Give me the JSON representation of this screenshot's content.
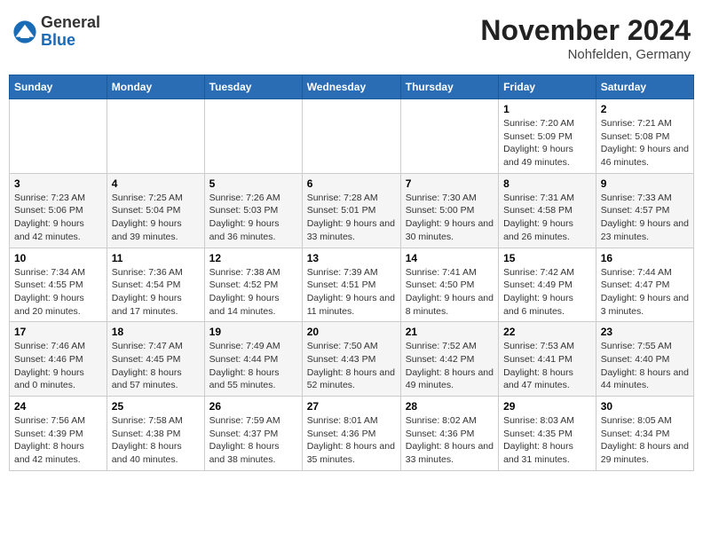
{
  "header": {
    "logo_general": "General",
    "logo_blue": "Blue",
    "month_title": "November 2024",
    "location": "Nohfelden, Germany"
  },
  "days_of_week": [
    "Sunday",
    "Monday",
    "Tuesday",
    "Wednesday",
    "Thursday",
    "Friday",
    "Saturday"
  ],
  "weeks": [
    [
      {
        "day": "",
        "info": ""
      },
      {
        "day": "",
        "info": ""
      },
      {
        "day": "",
        "info": ""
      },
      {
        "day": "",
        "info": ""
      },
      {
        "day": "",
        "info": ""
      },
      {
        "day": "1",
        "info": "Sunrise: 7:20 AM\nSunset: 5:09 PM\nDaylight: 9 hours and 49 minutes."
      },
      {
        "day": "2",
        "info": "Sunrise: 7:21 AM\nSunset: 5:08 PM\nDaylight: 9 hours and 46 minutes."
      }
    ],
    [
      {
        "day": "3",
        "info": "Sunrise: 7:23 AM\nSunset: 5:06 PM\nDaylight: 9 hours and 42 minutes."
      },
      {
        "day": "4",
        "info": "Sunrise: 7:25 AM\nSunset: 5:04 PM\nDaylight: 9 hours and 39 minutes."
      },
      {
        "day": "5",
        "info": "Sunrise: 7:26 AM\nSunset: 5:03 PM\nDaylight: 9 hours and 36 minutes."
      },
      {
        "day": "6",
        "info": "Sunrise: 7:28 AM\nSunset: 5:01 PM\nDaylight: 9 hours and 33 minutes."
      },
      {
        "day": "7",
        "info": "Sunrise: 7:30 AM\nSunset: 5:00 PM\nDaylight: 9 hours and 30 minutes."
      },
      {
        "day": "8",
        "info": "Sunrise: 7:31 AM\nSunset: 4:58 PM\nDaylight: 9 hours and 26 minutes."
      },
      {
        "day": "9",
        "info": "Sunrise: 7:33 AM\nSunset: 4:57 PM\nDaylight: 9 hours and 23 minutes."
      }
    ],
    [
      {
        "day": "10",
        "info": "Sunrise: 7:34 AM\nSunset: 4:55 PM\nDaylight: 9 hours and 20 minutes."
      },
      {
        "day": "11",
        "info": "Sunrise: 7:36 AM\nSunset: 4:54 PM\nDaylight: 9 hours and 17 minutes."
      },
      {
        "day": "12",
        "info": "Sunrise: 7:38 AM\nSunset: 4:52 PM\nDaylight: 9 hours and 14 minutes."
      },
      {
        "day": "13",
        "info": "Sunrise: 7:39 AM\nSunset: 4:51 PM\nDaylight: 9 hours and 11 minutes."
      },
      {
        "day": "14",
        "info": "Sunrise: 7:41 AM\nSunset: 4:50 PM\nDaylight: 9 hours and 8 minutes."
      },
      {
        "day": "15",
        "info": "Sunrise: 7:42 AM\nSunset: 4:49 PM\nDaylight: 9 hours and 6 minutes."
      },
      {
        "day": "16",
        "info": "Sunrise: 7:44 AM\nSunset: 4:47 PM\nDaylight: 9 hours and 3 minutes."
      }
    ],
    [
      {
        "day": "17",
        "info": "Sunrise: 7:46 AM\nSunset: 4:46 PM\nDaylight: 9 hours and 0 minutes."
      },
      {
        "day": "18",
        "info": "Sunrise: 7:47 AM\nSunset: 4:45 PM\nDaylight: 8 hours and 57 minutes."
      },
      {
        "day": "19",
        "info": "Sunrise: 7:49 AM\nSunset: 4:44 PM\nDaylight: 8 hours and 55 minutes."
      },
      {
        "day": "20",
        "info": "Sunrise: 7:50 AM\nSunset: 4:43 PM\nDaylight: 8 hours and 52 minutes."
      },
      {
        "day": "21",
        "info": "Sunrise: 7:52 AM\nSunset: 4:42 PM\nDaylight: 8 hours and 49 minutes."
      },
      {
        "day": "22",
        "info": "Sunrise: 7:53 AM\nSunset: 4:41 PM\nDaylight: 8 hours and 47 minutes."
      },
      {
        "day": "23",
        "info": "Sunrise: 7:55 AM\nSunset: 4:40 PM\nDaylight: 8 hours and 44 minutes."
      }
    ],
    [
      {
        "day": "24",
        "info": "Sunrise: 7:56 AM\nSunset: 4:39 PM\nDaylight: 8 hours and 42 minutes."
      },
      {
        "day": "25",
        "info": "Sunrise: 7:58 AM\nSunset: 4:38 PM\nDaylight: 8 hours and 40 minutes."
      },
      {
        "day": "26",
        "info": "Sunrise: 7:59 AM\nSunset: 4:37 PM\nDaylight: 8 hours and 38 minutes."
      },
      {
        "day": "27",
        "info": "Sunrise: 8:01 AM\nSunset: 4:36 PM\nDaylight: 8 hours and 35 minutes."
      },
      {
        "day": "28",
        "info": "Sunrise: 8:02 AM\nSunset: 4:36 PM\nDaylight: 8 hours and 33 minutes."
      },
      {
        "day": "29",
        "info": "Sunrise: 8:03 AM\nSunset: 4:35 PM\nDaylight: 8 hours and 31 minutes."
      },
      {
        "day": "30",
        "info": "Sunrise: 8:05 AM\nSunset: 4:34 PM\nDaylight: 8 hours and 29 minutes."
      }
    ]
  ]
}
